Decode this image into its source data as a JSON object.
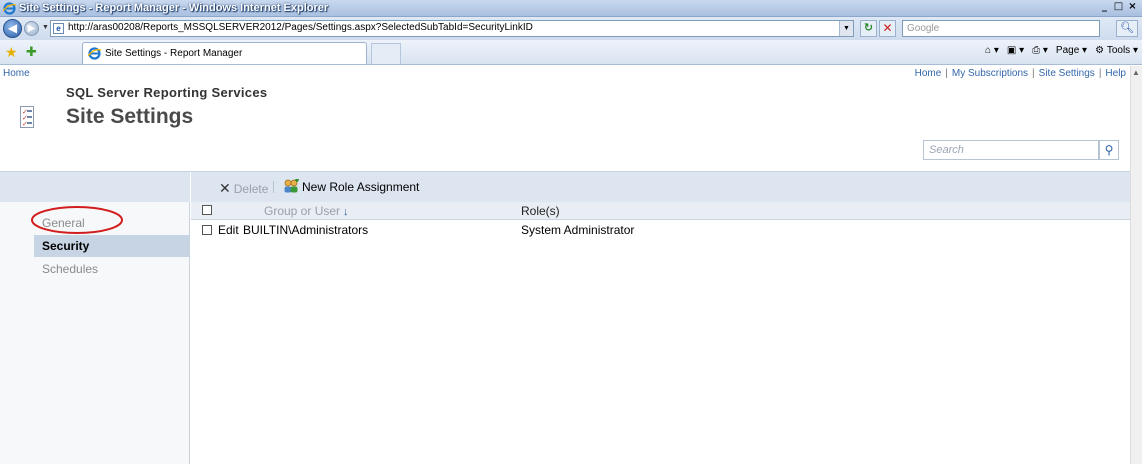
{
  "window": {
    "title": "Site Settings - Report Manager - Windows Internet Explorer",
    "controls": [
      "_",
      "□",
      "×"
    ]
  },
  "address_bar": {
    "url": "http://aras00208/Reports_MSSQLSERVER2012/Pages/Settings.aspx?SelectedSubTabId=SecurityLinkID",
    "search_placeholder": "Google"
  },
  "tab": {
    "label": "Site Settings - Report Manager"
  },
  "command_bar": {
    "page_label": "Page",
    "tools_label": "Tools"
  },
  "page": {
    "home_crumb": "Home",
    "top_links": [
      "Home",
      "My Subscriptions",
      "Site Settings",
      "Help"
    ],
    "app_title": "SQL Server Reporting Services",
    "page_title": "Site Settings",
    "search_placeholder": "Search"
  },
  "left_nav": {
    "items": [
      {
        "label": "General",
        "active": false
      },
      {
        "label": "Security",
        "active": true
      },
      {
        "label": "Schedules",
        "active": false
      }
    ]
  },
  "toolbar": {
    "delete_label": "Delete",
    "new_role_label": "New Role Assignment"
  },
  "grid": {
    "columns": [
      "Group or User",
      "Role(s)"
    ],
    "rows": [
      {
        "action": "Edit",
        "group_or_user": "BUILTIN\\Administrators",
        "roles": "System Administrator"
      }
    ]
  },
  "colors": {
    "accent_link": "#3366aa",
    "nav_active": "#c7d4e3",
    "highlight_ellipse": "#d21e1e"
  }
}
